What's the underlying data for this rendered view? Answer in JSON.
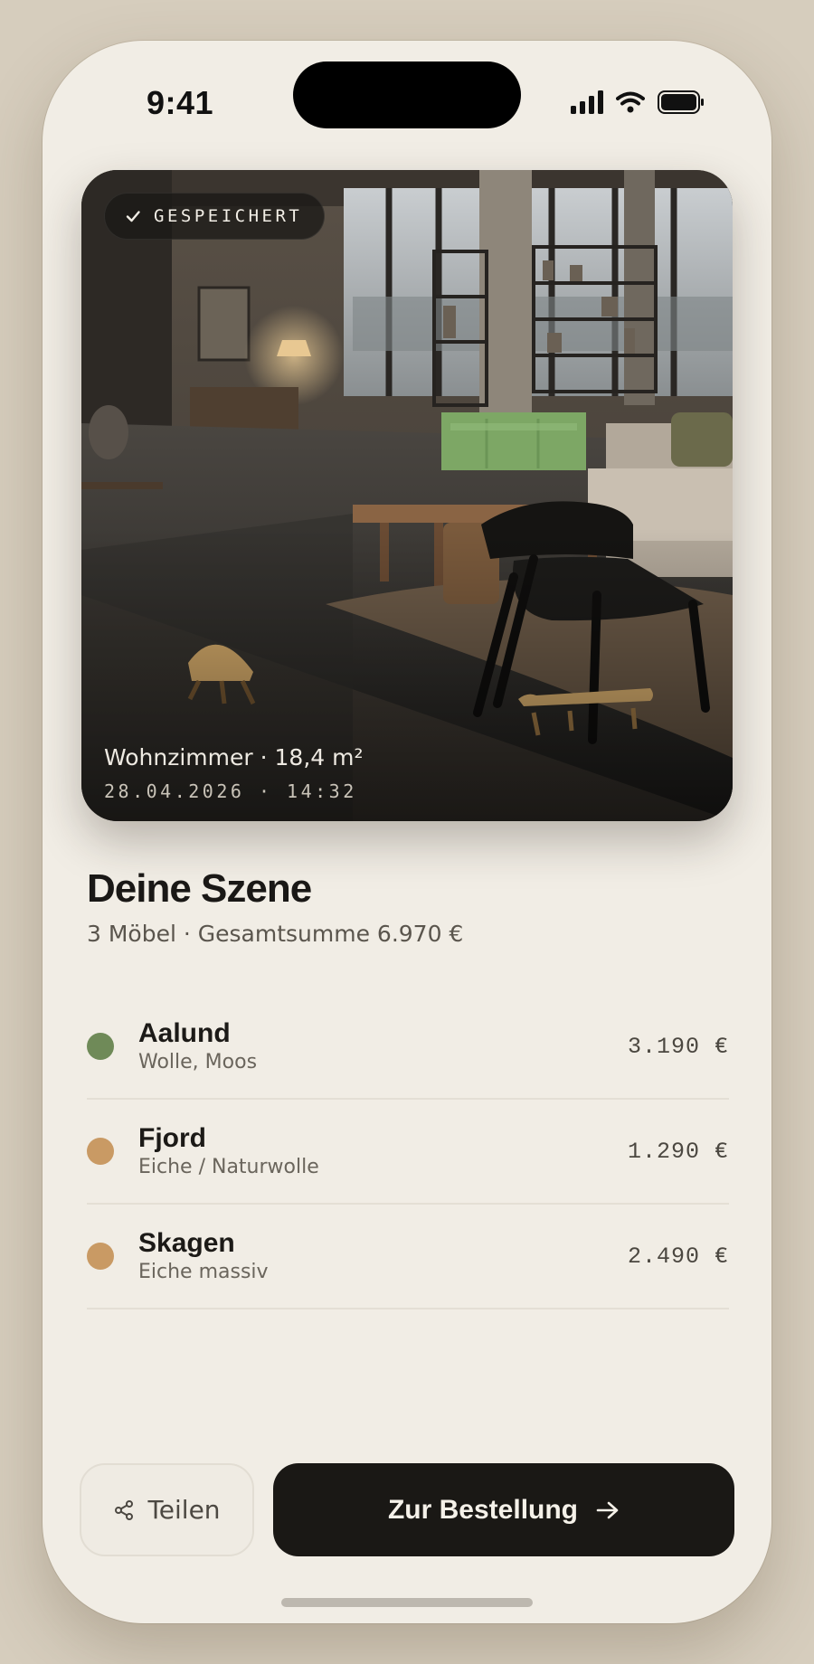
{
  "status_bar": {
    "time": "9:41"
  },
  "photo": {
    "badge": "GESPEICHERT",
    "room": "Wohnzimmer · 18,4 m²",
    "timestamp": "28.04.2026 · 14:32"
  },
  "scene": {
    "title": "Deine Szene",
    "subtitle": "3 Möbel · Gesamtsumme 6.970 €"
  },
  "items": [
    {
      "name": "Aalund",
      "material": "Wolle, Moos",
      "price": "3.190 €",
      "color": "#6f8a58"
    },
    {
      "name": "Fjord",
      "material": "Eiche / Naturwolle",
      "price": "1.290 €",
      "color": "#c99a64"
    },
    {
      "name": "Skagen",
      "material": "Eiche massiv",
      "price": "2.490 €",
      "color": "#c99a64"
    }
  ],
  "actions": {
    "share_label": "Teilen",
    "order_label": "Zur Bestellung"
  },
  "icons": {
    "badge": "check-icon",
    "share": "share-icon",
    "order": "arrow-right-icon"
  }
}
